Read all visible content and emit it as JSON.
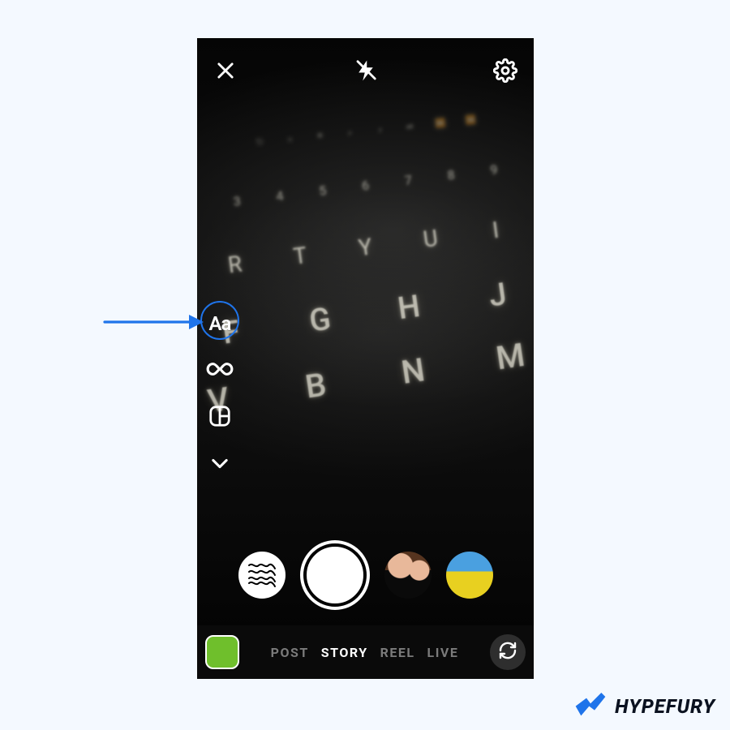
{
  "annotation": {
    "target": "text-tool",
    "color": "#1f74ea"
  },
  "topbar": {
    "close": "close",
    "flash": "flash-off",
    "settings": "settings"
  },
  "side_tools": {
    "text_label": "Aa",
    "boomerang": "infinity",
    "layout": "layout",
    "expand": "chevron-down"
  },
  "effects": {
    "waves": "wave-filter",
    "face": "face-filter",
    "landscape": "landscape-filter"
  },
  "modes": {
    "items": [
      "POST",
      "STORY",
      "REEL",
      "LIVE"
    ],
    "active": "STORY"
  },
  "bottom": {
    "flip": "camera-flip",
    "gallery": "gallery"
  },
  "keyboard_rows": {
    "fn": [
      "⎋",
      "☼",
      "☀",
      "⌕",
      "♪",
      "⏯",
      "⏩",
      "⏪"
    ],
    "num": [
      "3",
      "4",
      "5",
      "6",
      "7",
      "8",
      "9"
    ],
    "top": [
      "R",
      "T",
      "Y",
      "U",
      "I"
    ],
    "home": [
      "F",
      "G",
      "H",
      "J"
    ],
    "bot": [
      "V",
      "B",
      "N",
      "M"
    ]
  },
  "watermark": {
    "name": "HYPEFURY"
  }
}
